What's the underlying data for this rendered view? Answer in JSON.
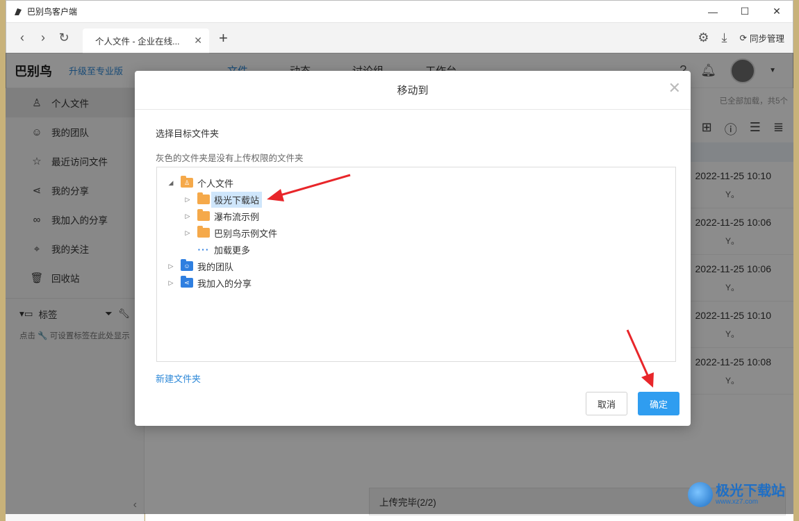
{
  "window": {
    "title": "巴别鸟客户端",
    "controls": {
      "minimize": "—",
      "maximize": "☐",
      "close": "✕"
    }
  },
  "browser": {
    "tab_label": "个人文件 - 企业在线...",
    "new_tab": "+",
    "sync_label": "同步管理"
  },
  "app": {
    "logo": "巴别鸟",
    "upgrade": "升级至专业版",
    "nav": [
      "文件",
      "动态",
      "讨论组",
      "工作台"
    ]
  },
  "sidebar": {
    "items": [
      {
        "label": "个人文件",
        "icon": "user-icon"
      },
      {
        "label": "我的团队",
        "icon": "team-icon"
      },
      {
        "label": "最近访问文件",
        "icon": "star-icon"
      },
      {
        "label": "我的分享",
        "icon": "share-icon"
      },
      {
        "label": "我加入的分享",
        "icon": "joined-share-icon"
      },
      {
        "label": "我的关注",
        "icon": "focus-icon"
      },
      {
        "label": "回收站",
        "icon": "trash-icon"
      }
    ],
    "tags_title": "标签",
    "tags_hint": "点击 🔧 可设置标签在此处显示"
  },
  "main": {
    "loaded_text": "已全部加载，共5个",
    "rows": [
      {
        "date": "2022-11-25 10:10",
        "sub": "Y。"
      },
      {
        "date": "2022-11-25 10:06",
        "sub": "Y。"
      },
      {
        "date": "2022-11-25 10:06",
        "sub": "Y。"
      },
      {
        "date": "2022-11-25 10:10",
        "sub": "Y。"
      },
      {
        "date": "2022-11-25 10:08",
        "sub": "Y。"
      }
    ],
    "upload_status": "上传完毕(2/2)"
  },
  "dialog": {
    "title": "移动到",
    "label": "选择目标文件夹",
    "hint": "灰色的文件夹是没有上传权限的文件夹",
    "tree": {
      "root": "个人文件",
      "children": [
        "极光下载站",
        "瀑布流示例",
        "巴别鸟示例文件"
      ],
      "load_more": "加载更多",
      "team": "我的团队",
      "joined": "我加入的分享"
    },
    "new_folder": "新建文件夹",
    "cancel": "取消",
    "confirm": "确定"
  },
  "watermark": {
    "text": "极光下载站",
    "url": "www.xz7.com"
  },
  "colors": {
    "accent": "#2f9df0",
    "link": "#2f89d8",
    "folder": "#f5a94a",
    "arrow": "#e8262a"
  }
}
